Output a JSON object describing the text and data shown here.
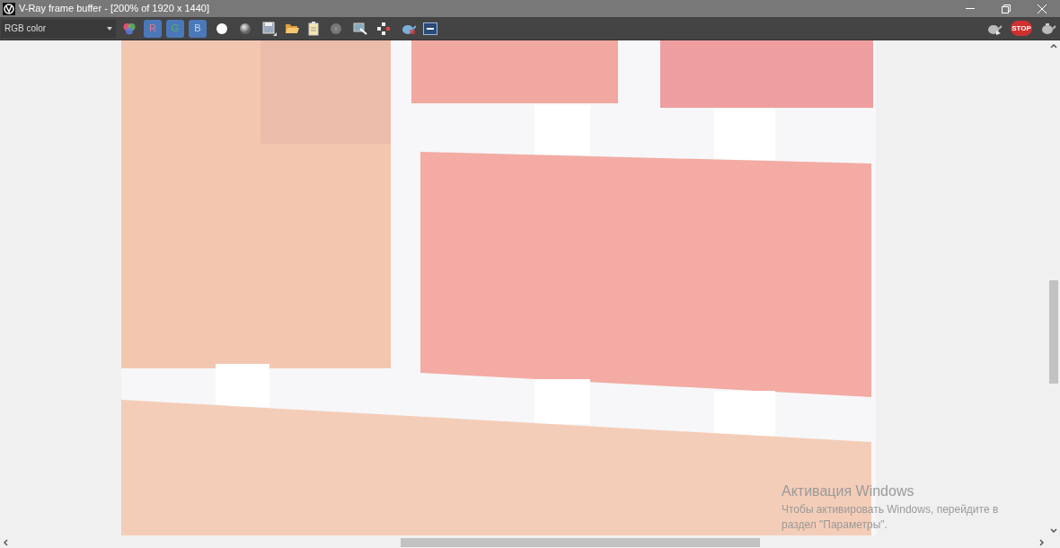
{
  "window": {
    "title": "V-Ray frame buffer - [200% of 1920 x 1440]"
  },
  "toolbar": {
    "channel_select": {
      "value": "RGB color"
    },
    "channel_buttons": [
      {
        "label": "R",
        "selected": true
      },
      {
        "label": "G",
        "selected": true
      },
      {
        "label": "B",
        "selected": true
      }
    ],
    "stop_button": {
      "label": "STOP"
    }
  },
  "activation_notice": {
    "title": "Активация Windows",
    "text": "Чтобы активировать Windows, перейдите в раздел \"Параметры\"."
  }
}
